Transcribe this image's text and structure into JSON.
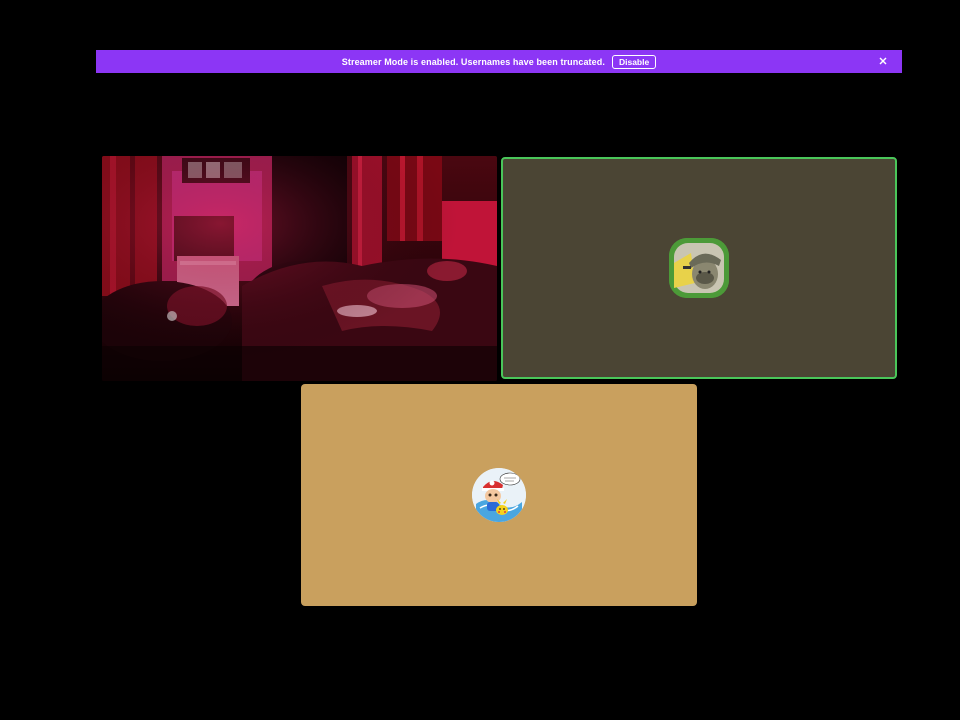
{
  "banner": {
    "message": "Streamer Mode is enabled. Usernames have been truncated.",
    "button_label": "Disable",
    "close_icon": "close-icon",
    "color": "#8c36f5"
  },
  "tiles": [
    {
      "kind": "camera-video",
      "content": "webcam feed, dim red-lit bedroom"
    },
    {
      "kind": "avatar",
      "speaking": true,
      "background": "#4b4534",
      "ring_color": "#4ac65a",
      "avatar_icon": "user-avatar-icon"
    },
    {
      "kind": "avatar",
      "speaking": false,
      "background": "#c9a05e",
      "avatar_icon": "user-avatar-icon"
    }
  ]
}
